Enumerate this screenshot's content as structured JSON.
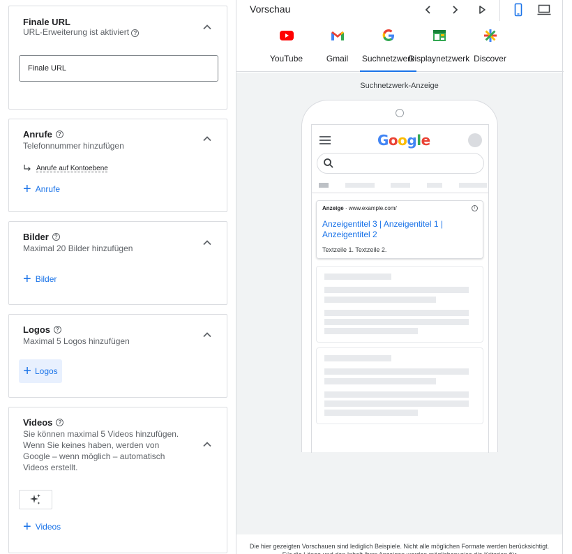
{
  "sections": {
    "final_url": {
      "title": "Finale URL",
      "subtitle": "URL-Erweiterung ist aktiviert",
      "input_label": "Finale URL"
    },
    "calls": {
      "title": "Anrufe",
      "subtitle": "Telefonnummer hinzufügen",
      "account_level_link": "Anrufe auf Kontoebene",
      "add_label": "Anrufe"
    },
    "images": {
      "title": "Bilder",
      "subtitle": "Maximal 20 Bilder hinzufügen",
      "add_label": "Bilder"
    },
    "logos": {
      "title": "Logos",
      "subtitle": "Maximal 5 Logos hinzufügen",
      "add_label": "Logos"
    },
    "videos": {
      "title": "Videos",
      "subtitle_lines": [
        "Sie können maximal 5 Videos hinzufügen.",
        "Wenn Sie keines haben, werden von",
        "Google – wenn möglich – automatisch",
        "Videos erstellt."
      ],
      "add_label": "Videos"
    }
  },
  "preview": {
    "title": "Vorschau",
    "tabs": [
      {
        "label": "YouTube",
        "icon": "youtube-icon"
      },
      {
        "label": "Gmail",
        "icon": "gmail-icon"
      },
      {
        "label": "Suchnetzwerk",
        "icon": "google-icon"
      },
      {
        "label": "Displaynetzwerk",
        "icon": "display-icon"
      },
      {
        "label": "Discover",
        "icon": "discover-icon"
      }
    ],
    "active_tab": "Suchnetzwerk",
    "caption": "Suchnetzwerk-Anzeige",
    "google_logo": [
      "G",
      "o",
      "o",
      "g",
      "l",
      "e"
    ],
    "google_colors": [
      "#4285f4",
      "#ea4335",
      "#fbbc05",
      "#4285f4",
      "#34a853",
      "#ea4335"
    ],
    "ad": {
      "label": "Anzeige",
      "separator": "·",
      "url": "www.example.com/",
      "headline": "Anzeigentitel 3 | Anzeigentitel 1 | Anzeigentitel 2",
      "description": "Textzeile 1. Textzeile 2."
    },
    "footer": "Die hier gezeigten Vorschauen sind lediglich Beispiele. Nicht alle möglichen Formate werden berücksichtigt. Für die Länge und den Inhalt Ihrer Anzeigen werden möglicherweise die Kriterien für"
  },
  "colors": {
    "accent": "#1a73e8",
    "active_bg": "#e8f0fe",
    "panel_bg": "#f1f3f4"
  }
}
